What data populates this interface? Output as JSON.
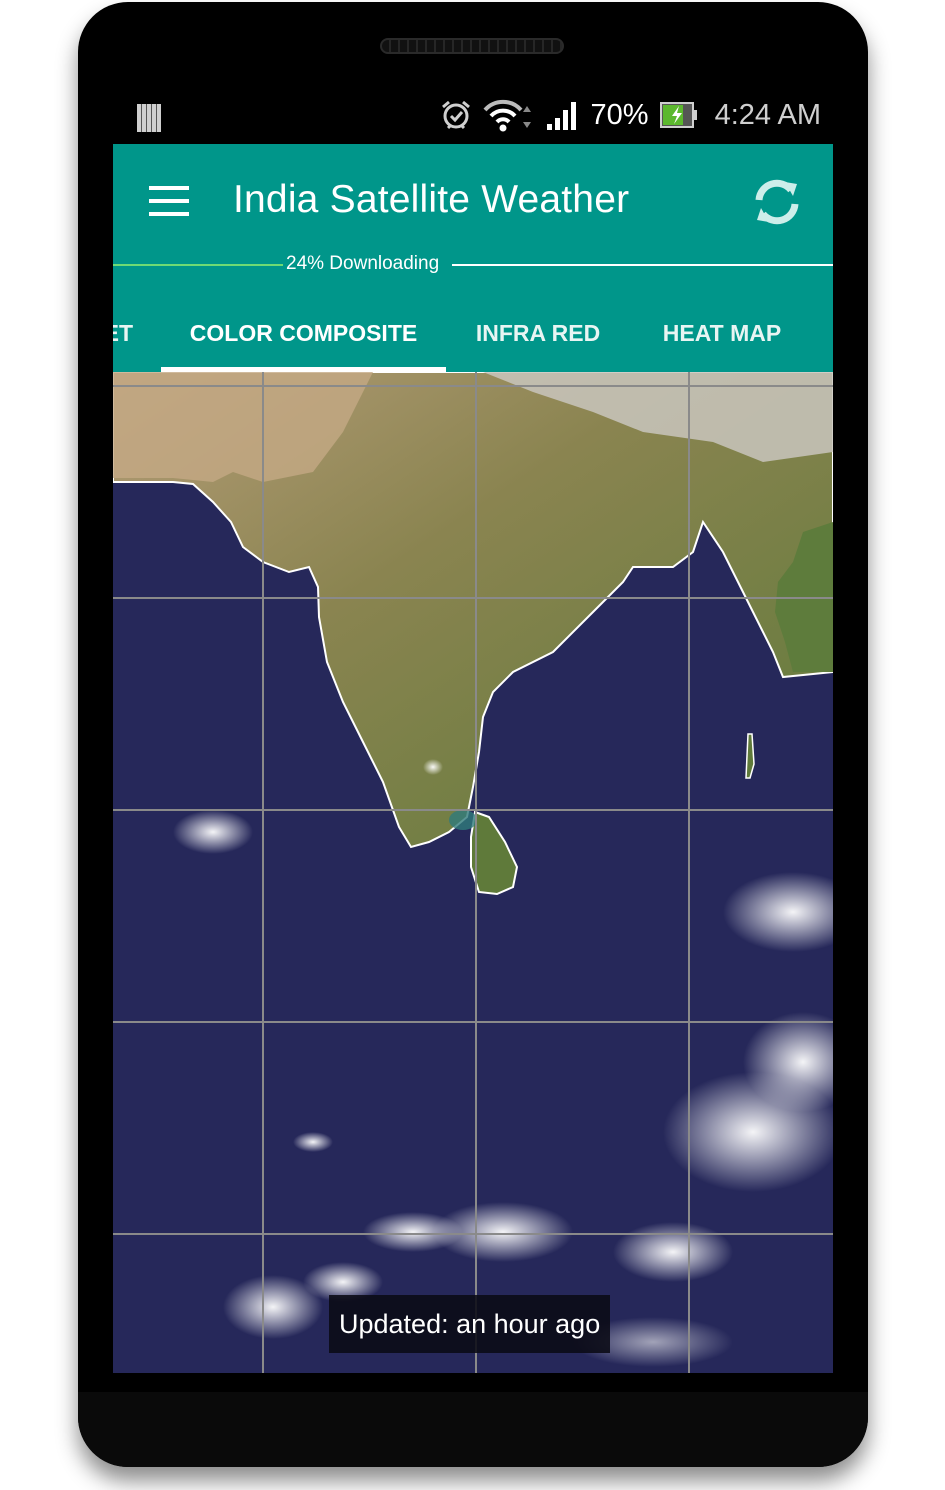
{
  "status_bar": {
    "notification_icon": "barcode-notification-icon",
    "icons": [
      "alarm-icon",
      "wifi-icon",
      "signal-icon"
    ],
    "battery_percent": "70%",
    "battery_icon": "battery-charging-icon",
    "time": "4:24 AM"
  },
  "app_bar": {
    "menu_icon": "hamburger-menu-icon",
    "title": "India Satellite Weather",
    "refresh_icon": "refresh-icon",
    "accent_color": "#00968a"
  },
  "download": {
    "label": "24% Downloading",
    "progress_percent": 24
  },
  "tabs": [
    {
      "label": "ET",
      "active": false
    },
    {
      "label": "COLOR COMPOSITE",
      "active": true
    },
    {
      "label": "INFRA RED",
      "active": false
    },
    {
      "label": "HEAT MAP",
      "active": false
    }
  ],
  "map": {
    "description": "Color composite satellite image of the Indian subcontinent and surrounding ocean with grid lines"
  },
  "toast": {
    "text": "Updated: an hour ago"
  }
}
